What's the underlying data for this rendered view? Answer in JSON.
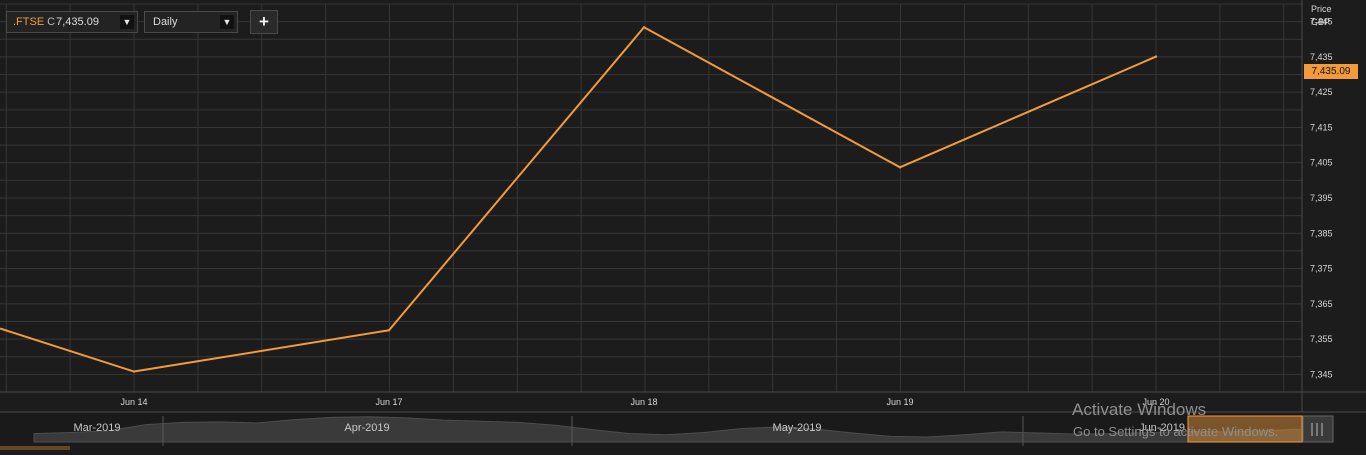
{
  "toolbar": {
    "instrument_symbol": ".FTSE",
    "close_prefix": "C",
    "close_value": "7,435.09",
    "frequency": "Daily",
    "add_label": "+",
    "caret": "▼"
  },
  "axis_header": {
    "line1": "Price",
    "line2": "GBP"
  },
  "last_price_badge": "7,435.09",
  "colors": {
    "background": "#1c1c1c",
    "grid": "#363636",
    "line": "#f39b3b",
    "navigator": "#3a3a3a"
  },
  "chart_data": {
    "type": "line",
    "title": "",
    "xlabel": "",
    "ylabel": "Price GBP",
    "categories": [
      "Jun 14",
      "Jun 17",
      "Jun 18",
      "Jun 19",
      "Jun 20"
    ],
    "series": [
      {
        "values": [
          7345.8,
          7357.5,
          7443.4,
          7403.7,
          7435.09
        ]
      }
    ],
    "ylim": [
      7340,
      7450
    ],
    "y_ticks": [
      7345,
      7355,
      7365,
      7375,
      7385,
      7395,
      7405,
      7415,
      7425,
      7435,
      7445
    ],
    "y_tick_labels": [
      "7,345",
      "7,355",
      "7,365",
      "7,375",
      "7,385",
      "7,395",
      "7,405",
      "7,415",
      "7,425",
      "7,435",
      "7,445"
    ],
    "grid": true,
    "legend": "none"
  },
  "navigator": {
    "labels": [
      "Mar-2019",
      "Apr-2019",
      "May-2019",
      "Jun-2019"
    ],
    "profile": [
      0.3,
      0.34,
      0.4,
      0.62,
      0.7,
      0.72,
      0.68,
      0.8,
      0.88,
      0.9,
      0.86,
      0.78,
      0.74,
      0.7,
      0.6,
      0.44,
      0.3,
      0.26,
      0.34,
      0.48,
      0.54,
      0.46,
      0.32,
      0.2,
      0.18,
      0.26,
      0.36,
      0.32,
      0.28,
      0.3,
      0.34,
      0.38,
      0.36,
      0.4,
      0.46
    ]
  },
  "watermark": {
    "line1": "Activate Windows",
    "line2": "Go to Settings to activate Windows."
  }
}
